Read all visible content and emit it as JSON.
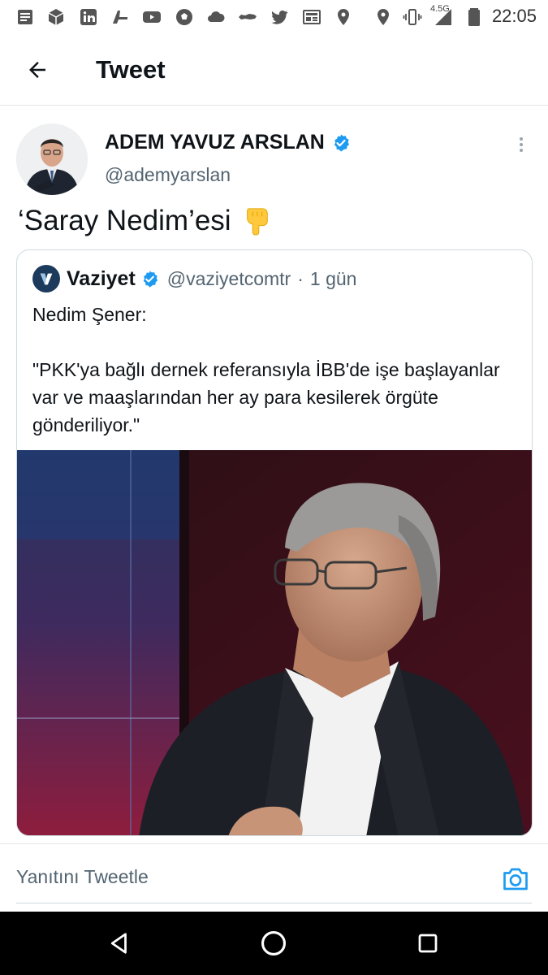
{
  "status_bar": {
    "time": "22:05",
    "network": "4.5G",
    "icons": [
      "notes-icon",
      "package-icon",
      "linkedin-icon",
      "airline-icon",
      "youtube-icon",
      "soccer-icon",
      "cloud-icon",
      "turkey-map-icon",
      "twitter-icon",
      "news-icon",
      "location-icon",
      "location-icon",
      "vibrate-icon",
      "signal-icon",
      "battery-icon"
    ]
  },
  "header": {
    "title": "Tweet"
  },
  "tweet": {
    "author_name": "ADEM YAVUZ ARSLAN",
    "author_handle": "@ademyarslan",
    "text": "‘Saray Nedim’esi",
    "emoji": "pointing-down-emoji",
    "quote": {
      "name": "Vaziyet",
      "handle": "@vaziyetcomtr",
      "separator": "·",
      "time": "1 gün",
      "body": "Nedim Şener:\n\n\"PKK'ya bağlı dernek referansıyla İBB'de işe başlayanlar var ve maaşlarından her ay para kesilerek örgüte gönderiliyor.\""
    }
  },
  "reply": {
    "placeholder": "Yanıtını Tweetle"
  },
  "colors": {
    "accent": "#1d9bf0",
    "text": "#0f1419",
    "secondary": "#536471",
    "border": "#cfd9de"
  }
}
